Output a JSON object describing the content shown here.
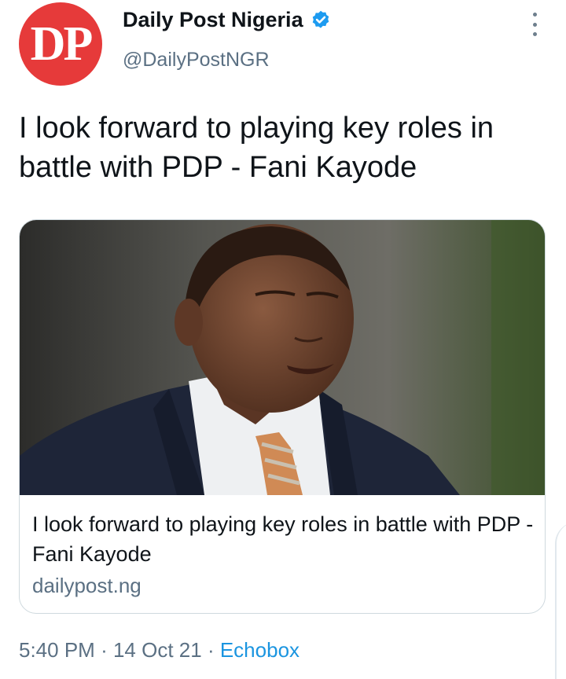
{
  "account": {
    "avatar_text": "DP",
    "name": "Daily Post Nigeria",
    "handle": "@DailyPostNGR",
    "verified": true
  },
  "tweet": {
    "text": "I look forward to playing key roles in battle with PDP - Fani Kayode"
  },
  "card": {
    "title": "I look forward to playing key roles in battle with PDP - Fani Kayode",
    "domain": "dailypost.ng",
    "image_subject": "man-in-suit-photo"
  },
  "meta": {
    "time": "5:40 PM",
    "date": "14 Oct 21",
    "separator": "·",
    "source": "Echobox"
  },
  "colors": {
    "avatar": "#e63a3a",
    "verified": "#1d9bf0",
    "secondary_text": "#5b7083",
    "link": "#1b95e0"
  },
  "icons": {
    "verified": "verified-badge-icon",
    "more": "more-options-icon"
  }
}
